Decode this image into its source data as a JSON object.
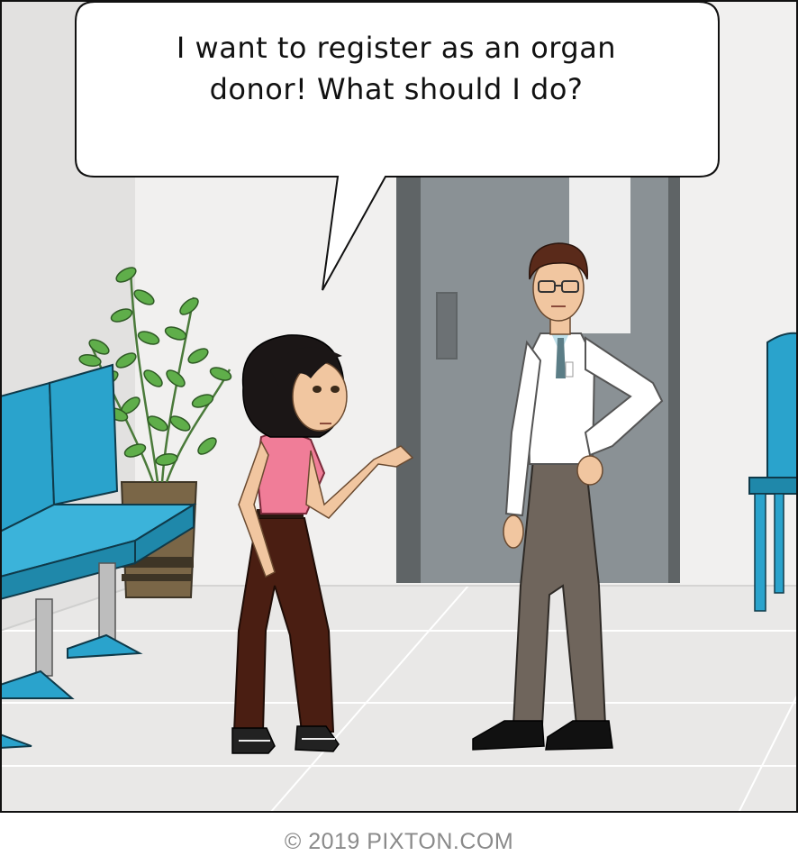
{
  "speech_bubble": {
    "line1": "I want to register as an organ",
    "line2": "donor! What should I do?"
  },
  "footer": {
    "credit": "© 2019 PIXTON.COM"
  },
  "colors": {
    "chair_blue": "#2aa3cc",
    "wall": "#f1f0ef",
    "floor": "#e9e8e7",
    "door": "#8a9195",
    "shirt_pink": "#f07d98",
    "lab_coat": "#ffffff",
    "trousers_gray": "#6f655c"
  },
  "characters": [
    "woman-character",
    "doctor-character"
  ],
  "icons": [
    "plant-icon",
    "bench-icon",
    "chair-icon",
    "door-icon"
  ]
}
